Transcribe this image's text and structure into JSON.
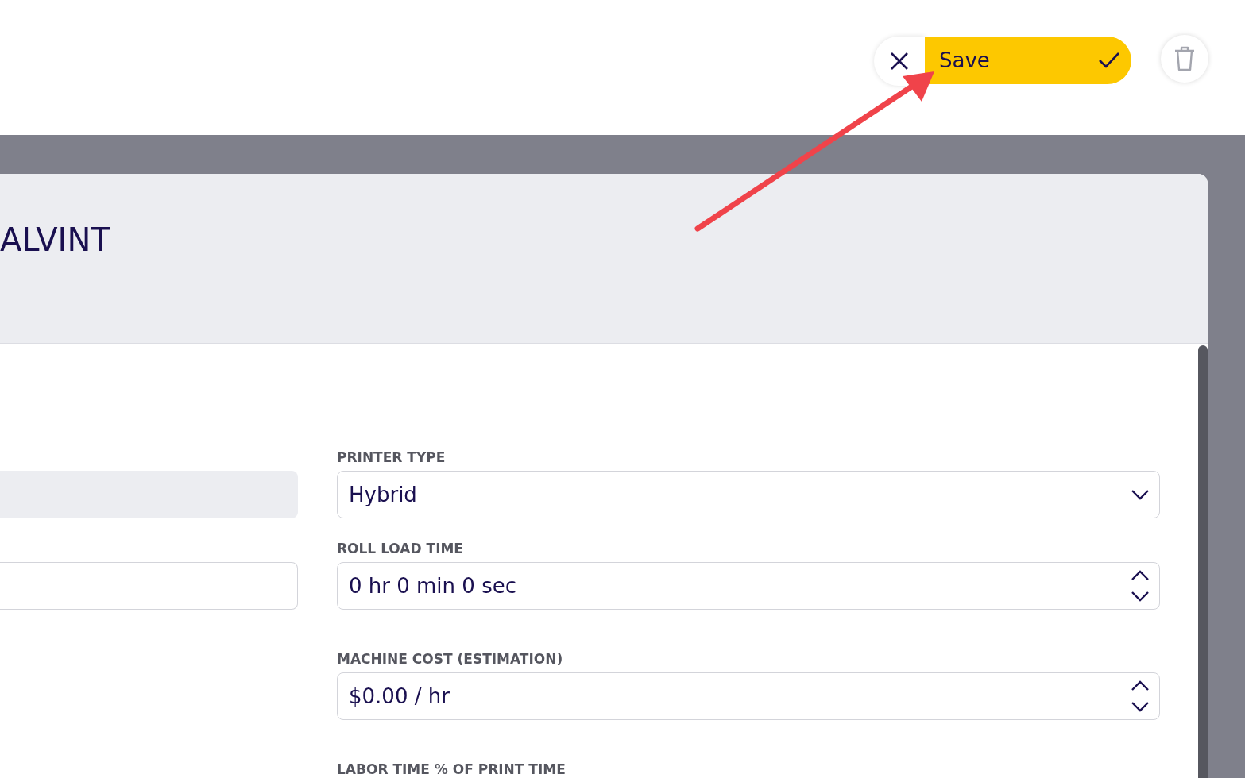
{
  "actions": {
    "save": "Save"
  },
  "record": {
    "title": "ALVINT"
  },
  "left_fields": [
    {
      "kind": "disabled"
    },
    {
      "kind": "text"
    }
  ],
  "right_fields": [
    {
      "label": "PRINTER TYPE",
      "kind": "select",
      "value": "Hybrid"
    },
    {
      "label": "ROLL LOAD TIME",
      "kind": "spinner",
      "value": "0 hr 0 min 0 sec"
    },
    {
      "label": "MACHINE COST (ESTIMATION)",
      "kind": "spinner",
      "value": "$0.00 / hr"
    },
    {
      "label": "LABOR TIME % OF PRINT TIME",
      "kind": "none"
    }
  ]
}
